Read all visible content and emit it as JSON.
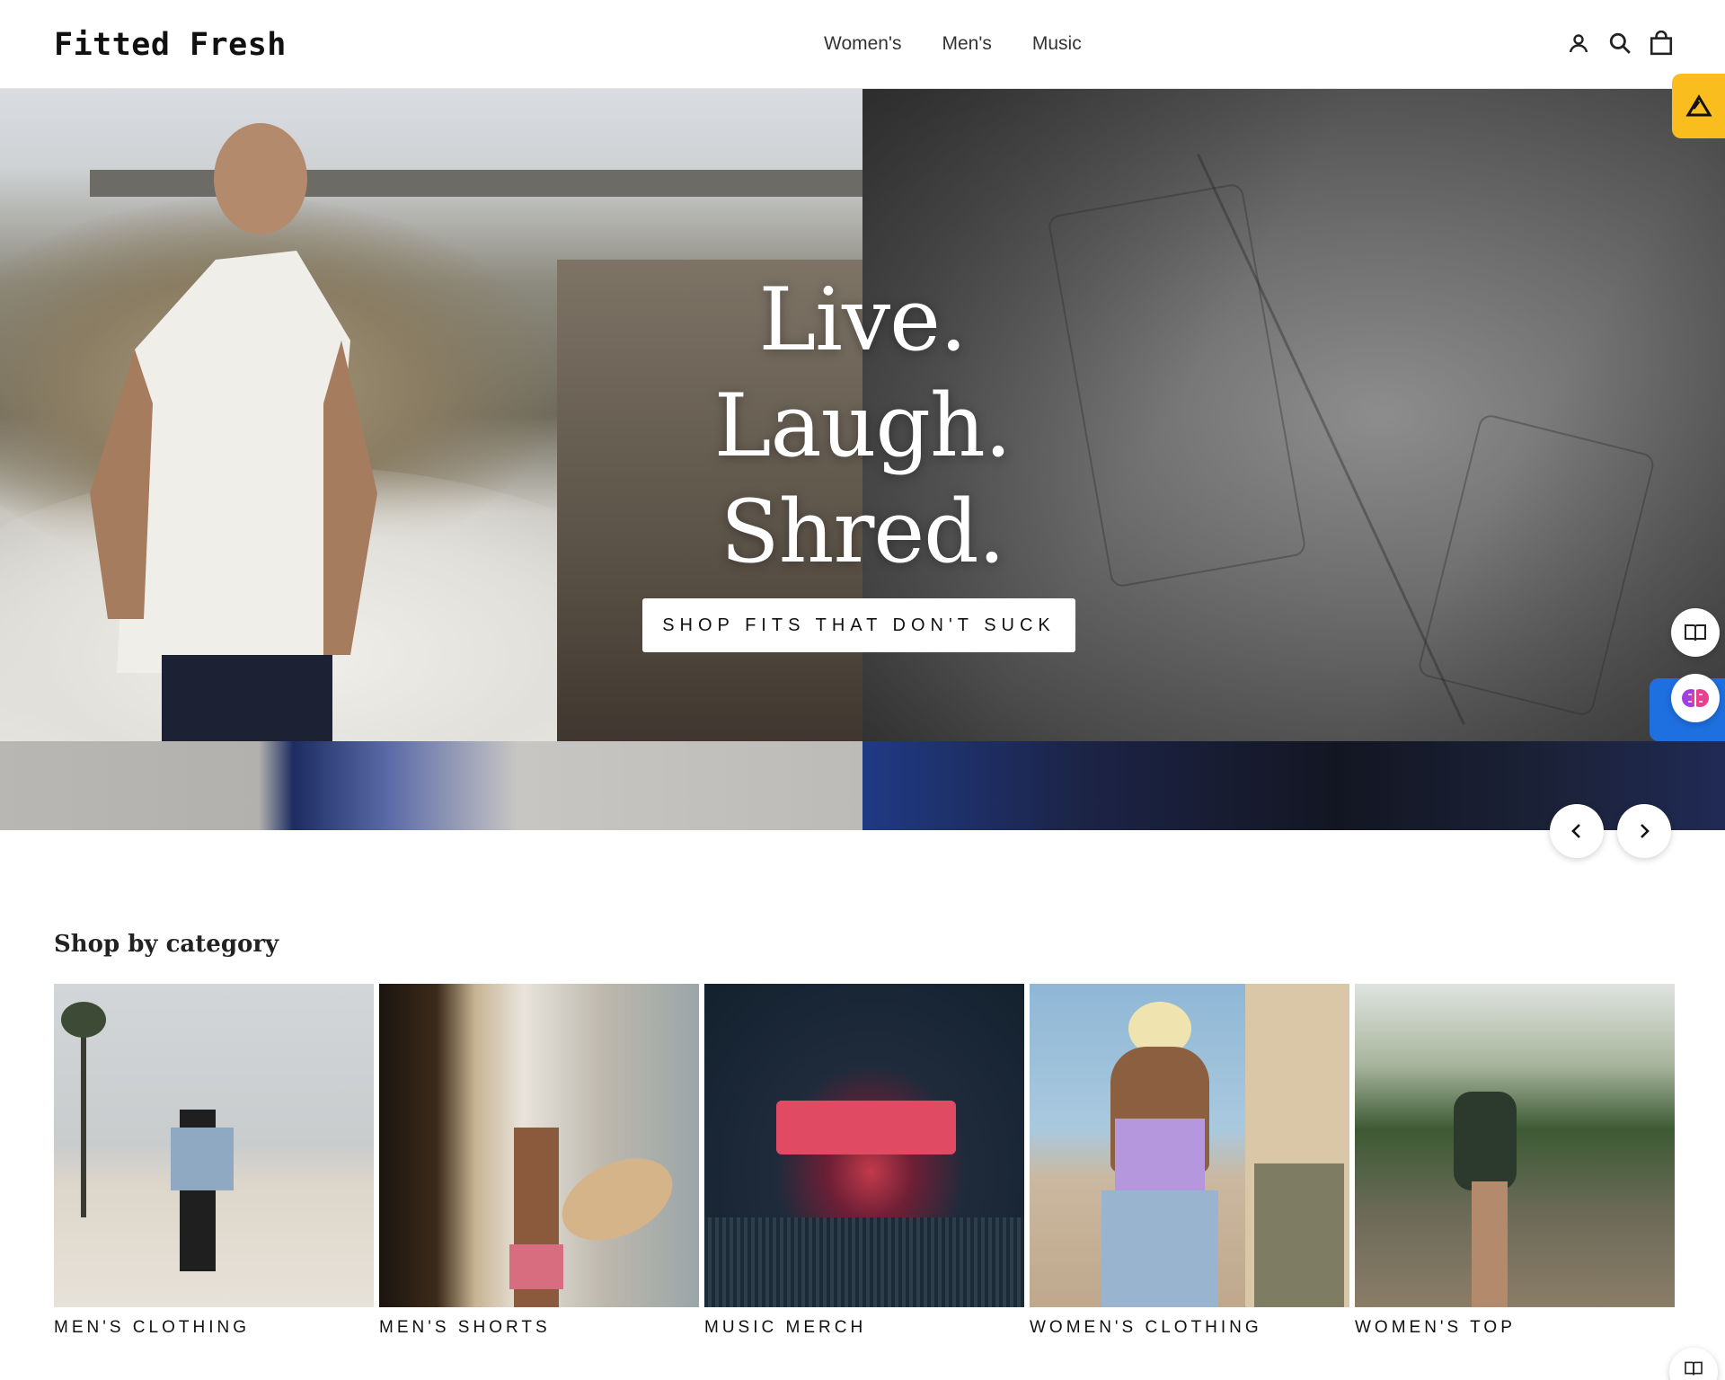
{
  "brand": {
    "name": "Fitted Fresh"
  },
  "nav": {
    "items": [
      "Women's",
      "Men's",
      "Music"
    ]
  },
  "header_icons": {
    "account": "account-icon",
    "search": "search-icon",
    "cart": "cart-icon"
  },
  "hero": {
    "line1": "Live.",
    "line2": "Laugh.",
    "line3": "Shred.",
    "cta": "SHOP FITS THAT DON'T SUCK"
  },
  "carousel": {
    "prev": "chevron-left-icon",
    "next": "chevron-right-icon"
  },
  "categories": {
    "title": "Shop by category",
    "items": [
      {
        "label": "MEN'S CLOTHING"
      },
      {
        "label": "MEN'S SHORTS"
      },
      {
        "label": "MUSIC MERCH"
      },
      {
        "label": "WOMEN'S CLOTHING"
      },
      {
        "label": "WOMEN'S TOP"
      }
    ]
  },
  "colors": {
    "widget_yellow": "#f9bd1d",
    "widget_blue": "#1e6fe0",
    "text": "#111111"
  }
}
